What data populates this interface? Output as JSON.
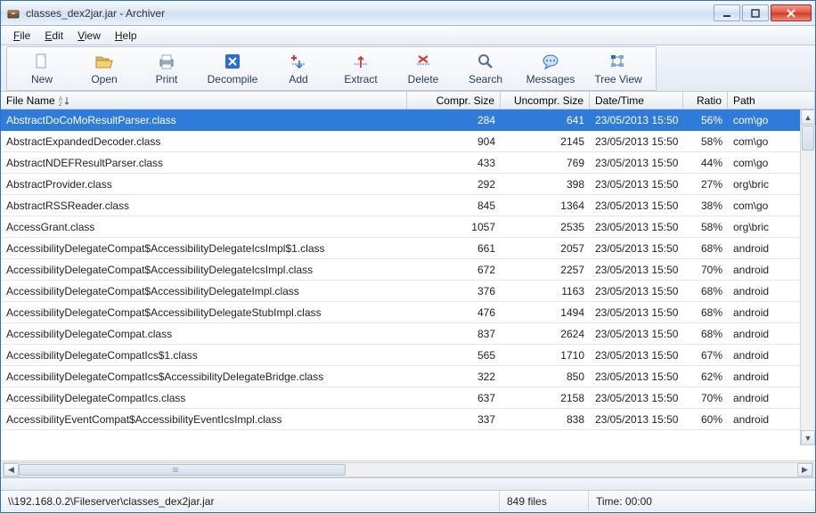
{
  "window": {
    "title": "classes_dex2jar.jar - Archiver"
  },
  "menus": {
    "file": "File",
    "edit": "Edit",
    "view": "View",
    "help": "Help"
  },
  "toolbar": {
    "new": "New",
    "open": "Open",
    "print": "Print",
    "decompile": "Decompile",
    "add": "Add",
    "extract": "Extract",
    "delete": "Delete",
    "search": "Search",
    "messages": "Messages",
    "treeview": "Tree View"
  },
  "columns": {
    "name": "File Name",
    "compr": "Compr. Size",
    "uncompr": "Uncompr. Size",
    "date": "Date/Time",
    "ratio": "Ratio",
    "path": "Path"
  },
  "rows": [
    {
      "name": "AbstractDoCoMoResultParser.class",
      "compr": "284",
      "uncompr": "641",
      "date": "23/05/2013 15:50",
      "ratio": "56%",
      "path": "com\\go",
      "selected": true
    },
    {
      "name": "AbstractExpandedDecoder.class",
      "compr": "904",
      "uncompr": "2145",
      "date": "23/05/2013 15:50",
      "ratio": "58%",
      "path": "com\\go"
    },
    {
      "name": "AbstractNDEFResultParser.class",
      "compr": "433",
      "uncompr": "769",
      "date": "23/05/2013 15:50",
      "ratio": "44%",
      "path": "com\\go"
    },
    {
      "name": "AbstractProvider.class",
      "compr": "292",
      "uncompr": "398",
      "date": "23/05/2013 15:50",
      "ratio": "27%",
      "path": "org\\bric"
    },
    {
      "name": "AbstractRSSReader.class",
      "compr": "845",
      "uncompr": "1364",
      "date": "23/05/2013 15:50",
      "ratio": "38%",
      "path": "com\\go"
    },
    {
      "name": "AccessGrant.class",
      "compr": "1057",
      "uncompr": "2535",
      "date": "23/05/2013 15:50",
      "ratio": "58%",
      "path": "org\\bric"
    },
    {
      "name": "AccessibilityDelegateCompat$AccessibilityDelegateIcsImpl$1.class",
      "compr": "661",
      "uncompr": "2057",
      "date": "23/05/2013 15:50",
      "ratio": "68%",
      "path": "android"
    },
    {
      "name": "AccessibilityDelegateCompat$AccessibilityDelegateIcsImpl.class",
      "compr": "672",
      "uncompr": "2257",
      "date": "23/05/2013 15:50",
      "ratio": "70%",
      "path": "android"
    },
    {
      "name": "AccessibilityDelegateCompat$AccessibilityDelegateImpl.class",
      "compr": "376",
      "uncompr": "1163",
      "date": "23/05/2013 15:50",
      "ratio": "68%",
      "path": "android"
    },
    {
      "name": "AccessibilityDelegateCompat$AccessibilityDelegateStubImpl.class",
      "compr": "476",
      "uncompr": "1494",
      "date": "23/05/2013 15:50",
      "ratio": "68%",
      "path": "android"
    },
    {
      "name": "AccessibilityDelegateCompat.class",
      "compr": "837",
      "uncompr": "2624",
      "date": "23/05/2013 15:50",
      "ratio": "68%",
      "path": "android"
    },
    {
      "name": "AccessibilityDelegateCompatIcs$1.class",
      "compr": "565",
      "uncompr": "1710",
      "date": "23/05/2013 15:50",
      "ratio": "67%",
      "path": "android"
    },
    {
      "name": "AccessibilityDelegateCompatIcs$AccessibilityDelegateBridge.class",
      "compr": "322",
      "uncompr": "850",
      "date": "23/05/2013 15:50",
      "ratio": "62%",
      "path": "android"
    },
    {
      "name": "AccessibilityDelegateCompatIcs.class",
      "compr": "637",
      "uncompr": "2158",
      "date": "23/05/2013 15:50",
      "ratio": "70%",
      "path": "android"
    },
    {
      "name": "AccessibilityEventCompat$AccessibilityEventIcsImpl.class",
      "compr": "337",
      "uncompr": "838",
      "date": "23/05/2013 15:50",
      "ratio": "60%",
      "path": "android"
    }
  ],
  "status": {
    "path": "\\\\192.168.0.2\\Fileserver\\classes_dex2jar.jar",
    "count": "849 files",
    "time": "Time: 00:00"
  }
}
